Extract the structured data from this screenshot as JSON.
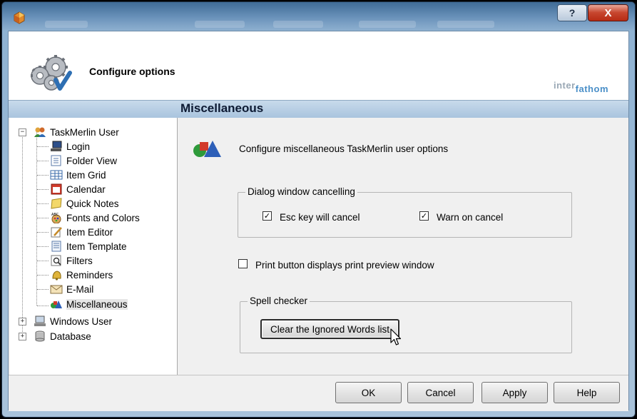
{
  "window": {
    "help_glyph": "?",
    "close_glyph": "X"
  },
  "header": {
    "title": "Configure options",
    "brand_part1": "inter",
    "brand_part2": "fathom"
  },
  "section": {
    "title": "Miscellaneous"
  },
  "tree": {
    "root": {
      "label": "TaskMerlin User",
      "expander": "−"
    },
    "children": [
      {
        "label": "Login",
        "icon": "computer-icon"
      },
      {
        "label": "Folder View",
        "icon": "folder-view-icon"
      },
      {
        "label": "Item Grid",
        "icon": "grid-icon"
      },
      {
        "label": "Calendar",
        "icon": "calendar-icon"
      },
      {
        "label": "Quick Notes",
        "icon": "note-icon"
      },
      {
        "label": "Fonts and Colors",
        "icon": "fonts-icon"
      },
      {
        "label": "Item Editor",
        "icon": "editor-icon"
      },
      {
        "label": "Item Template",
        "icon": "template-icon"
      },
      {
        "label": "Filters",
        "icon": "filter-icon"
      },
      {
        "label": "Reminders",
        "icon": "bell-icon"
      },
      {
        "label": "E-Mail",
        "icon": "envelope-icon"
      },
      {
        "label": "Miscellaneous",
        "icon": "shapes-icon"
      }
    ],
    "others": [
      {
        "label": "Windows User",
        "expander": "+",
        "icon": "computer-icon"
      },
      {
        "label": "Database",
        "expander": "+",
        "icon": "database-icon"
      }
    ]
  },
  "main": {
    "description": "Configure miscellaneous TaskMerlin user options",
    "dialog_group": {
      "title": "Dialog window cancelling",
      "esc_label": "Esc key will cancel",
      "esc_checked": true,
      "warn_label": "Warn on cancel",
      "warn_checked": true,
      "check_glyph": "✓"
    },
    "print_preview": {
      "label": "Print button displays print preview window",
      "checked": false
    },
    "spell_group": {
      "title": "Spell checker",
      "button_label": "Clear the Ignored Words list"
    }
  },
  "footer": {
    "ok": "OK",
    "cancel": "Cancel",
    "apply": "Apply",
    "help": "Help"
  }
}
